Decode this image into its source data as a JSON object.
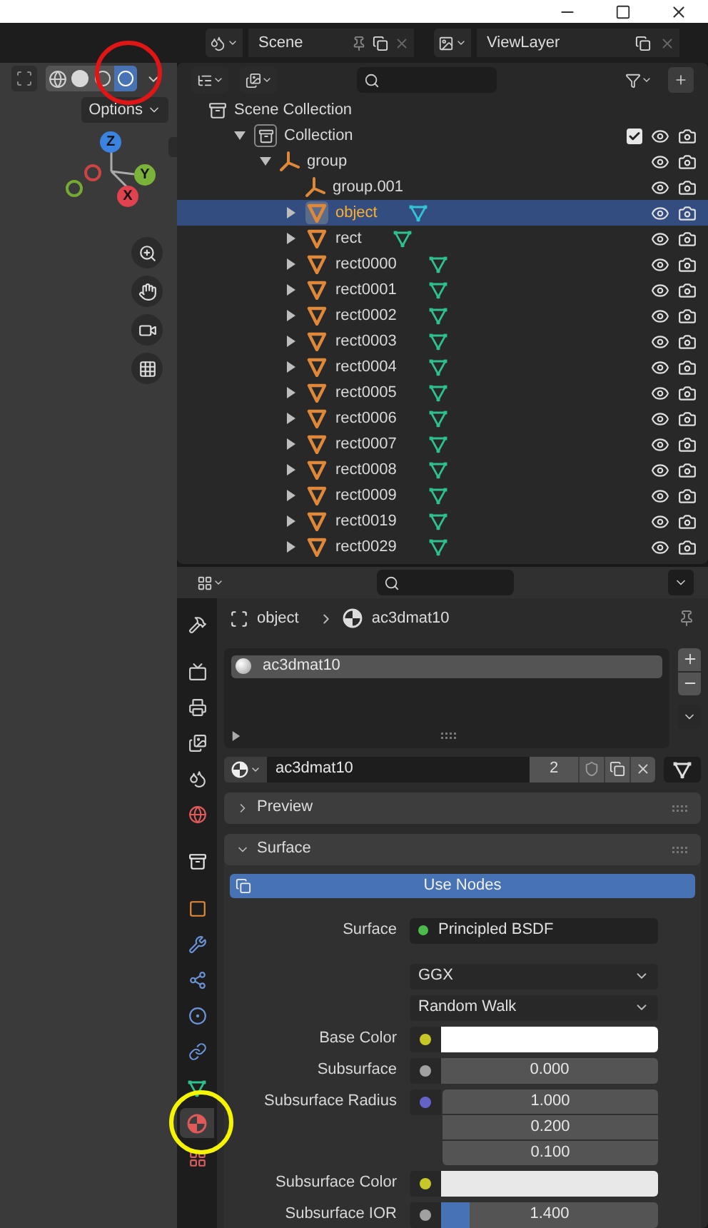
{
  "scene_bar": {
    "scene": "Scene",
    "view_layer": "ViewLayer"
  },
  "viewport": {
    "shading": [
      {
        "kind": "xray",
        "selected": false
      },
      {
        "kind": "wireframe",
        "selected": false
      },
      {
        "kind": "solid",
        "selected": false
      },
      {
        "kind": "material",
        "selected": false
      },
      {
        "kind": "rendered",
        "selected": true
      }
    ],
    "options": "Options",
    "gizmo": {
      "z": "Z",
      "y": "Y",
      "x": "X"
    }
  },
  "outliner": {
    "items": [
      {
        "name": "Scene Collection",
        "kind": "scene",
        "selected": false,
        "children": [
          {
            "name": "Collection",
            "kind": "collection",
            "expanded": true,
            "checked": true,
            "selected": false,
            "children": [
              {
                "name": "group",
                "kind": "empty",
                "expanded": true,
                "selected": false,
                "children": [
                  {
                    "name": "group.001",
                    "kind": "empty",
                    "selected": false
                  },
                  {
                    "name": "object",
                    "kind": "mesh",
                    "expanded": false,
                    "selected": true
                  },
                  {
                    "name": "rect",
                    "kind": "mesh",
                    "expanded": false,
                    "selected": false
                  },
                  {
                    "name": "rect0000",
                    "kind": "mesh",
                    "expanded": false,
                    "selected": false
                  },
                  {
                    "name": "rect0001",
                    "kind": "mesh",
                    "expanded": false,
                    "selected": false
                  },
                  {
                    "name": "rect0002",
                    "kind": "mesh",
                    "expanded": false,
                    "selected": false
                  },
                  {
                    "name": "rect0003",
                    "kind": "mesh",
                    "expanded": false,
                    "selected": false
                  },
                  {
                    "name": "rect0004",
                    "kind": "mesh",
                    "expanded": false,
                    "selected": false
                  },
                  {
                    "name": "rect0005",
                    "kind": "mesh",
                    "expanded": false,
                    "selected": false
                  },
                  {
                    "name": "rect0006",
                    "kind": "mesh",
                    "expanded": false,
                    "selected": false
                  },
                  {
                    "name": "rect0007",
                    "kind": "mesh",
                    "expanded": false,
                    "selected": false
                  },
                  {
                    "name": "rect0008",
                    "kind": "mesh",
                    "expanded": false,
                    "selected": false
                  },
                  {
                    "name": "rect0009",
                    "kind": "mesh",
                    "expanded": false,
                    "selected": false
                  },
                  {
                    "name": "rect0019",
                    "kind": "mesh",
                    "expanded": false,
                    "selected": false
                  },
                  {
                    "name": "rect0029",
                    "kind": "mesh",
                    "expanded": false,
                    "selected": false
                  }
                ]
              }
            ]
          }
        ]
      }
    ]
  },
  "properties": {
    "tabs": [
      {
        "kind": "tool",
        "selected": false
      },
      {
        "kind": "render",
        "selected": false
      },
      {
        "kind": "output",
        "selected": false
      },
      {
        "kind": "view_layer",
        "selected": false
      },
      {
        "kind": "scene",
        "selected": false
      },
      {
        "kind": "world",
        "selected": false
      },
      {
        "kind": "collection",
        "selected": false
      },
      {
        "kind": "object",
        "selected": false
      },
      {
        "kind": "modifiers",
        "selected": false
      },
      {
        "kind": "particles",
        "selected": false
      },
      {
        "kind": "physics",
        "selected": false
      },
      {
        "kind": "constraints",
        "selected": false
      },
      {
        "kind": "data",
        "selected": false
      },
      {
        "kind": "material",
        "selected": true
      },
      {
        "kind": "texture",
        "selected": false
      }
    ],
    "breadcrumb": {
      "object": "object",
      "material": "ac3dmat10"
    },
    "slots": [
      {
        "name": "ac3dmat10",
        "selected": true
      }
    ],
    "material": {
      "name": "ac3dmat10",
      "users": "2"
    },
    "panels": [
      {
        "title": "Preview",
        "expanded": false
      },
      {
        "title": "Surface",
        "expanded": true
      }
    ],
    "use_nodes": "Use Nodes",
    "inputs": [
      {
        "kind": "shader",
        "label": "Surface",
        "value": "Principled BSDF"
      },
      {
        "kind": "dropdown",
        "value": "GGX"
      },
      {
        "kind": "dropdown",
        "value": "Random Walk"
      },
      {
        "kind": "color",
        "label": "Base Color",
        "color": "#ffffff"
      },
      {
        "kind": "number",
        "label": "Subsurface",
        "value": "0.000"
      },
      {
        "kind": "vector",
        "label": "Subsurface Radius",
        "values": [
          "1.000",
          "0.200",
          "0.100"
        ]
      },
      {
        "kind": "color",
        "label": "Subsurface Color",
        "color": "#e8e8e8"
      },
      {
        "kind": "slider",
        "label": "Subsurface IOR",
        "value": "1.400",
        "level": 0.13
      }
    ]
  }
}
